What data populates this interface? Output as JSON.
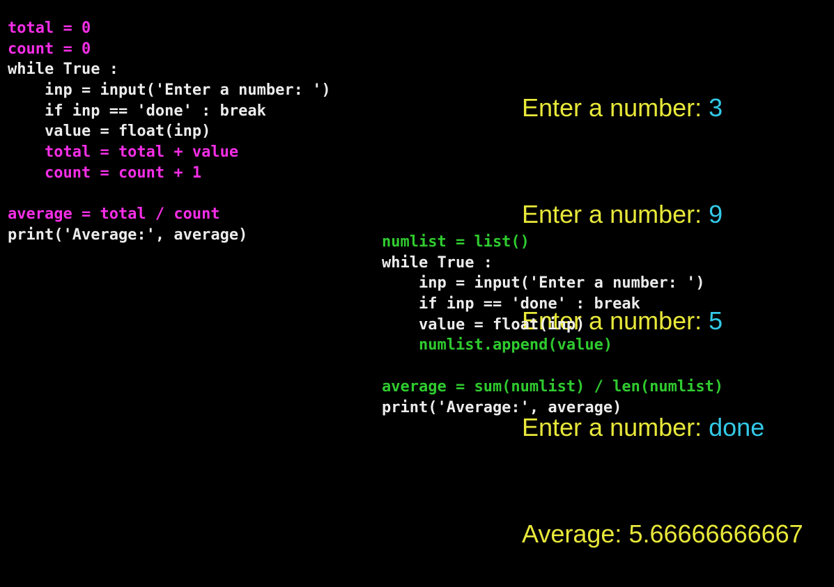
{
  "left_code": {
    "lines": [
      {
        "text": "total = 0",
        "color": "#f52ee6"
      },
      {
        "text": "count = 0",
        "color": "#f52ee6"
      },
      {
        "text": "while True :",
        "color": "#ececec"
      },
      {
        "text": "    inp = input('Enter a number: ')",
        "color": "#ececec"
      },
      {
        "text": "    if inp == 'done' : break",
        "color": "#ececec"
      },
      {
        "text": "    value = float(inp)",
        "color": "#ececec"
      },
      {
        "text": "    total = total + value",
        "color": "#f52ee6"
      },
      {
        "text": "    count = count + 1",
        "color": "#f52ee6"
      },
      {
        "text": "",
        "color": "#ececec"
      },
      {
        "text": "average = total / count",
        "color": "#f52ee6"
      },
      {
        "text": "print('Average:', average)",
        "color": "#ececec"
      }
    ]
  },
  "console_output": {
    "lines": [
      {
        "prompt": "Enter a number: ",
        "input": "3"
      },
      {
        "prompt": "Enter a number: ",
        "input": "9"
      },
      {
        "prompt": "Enter a number: ",
        "input": "5"
      },
      {
        "prompt": "Enter a number: ",
        "input": "done"
      },
      {
        "prompt": "Average: 5.66666666667",
        "input": ""
      }
    ],
    "prompt_color": "#e8e83a",
    "input_color": "#33c9e8"
  },
  "right_code": {
    "lines": [
      {
        "text": "numlist = list()",
        "color": "#2fcb2f"
      },
      {
        "text": "while True :",
        "color": "#ececec"
      },
      {
        "text": "    inp = input('Enter a number: ')",
        "color": "#ececec"
      },
      {
        "text": "    if inp == 'done' : break",
        "color": "#ececec"
      },
      {
        "text": "    value = float(inp)",
        "color": "#ececec"
      },
      {
        "text": "    numlist.append(value)",
        "color": "#2fcb2f"
      },
      {
        "text": "",
        "color": "#ececec"
      },
      {
        "text": "average = sum(numlist) / len(numlist)",
        "color": "#2fcb2f"
      },
      {
        "text": "print('Average:', average)",
        "color": "#ececec"
      }
    ]
  },
  "colors": {
    "background": "#000000",
    "default_code": "#ececec",
    "highlight_counter": "#f52ee6",
    "highlight_list": "#2fcb2f"
  }
}
